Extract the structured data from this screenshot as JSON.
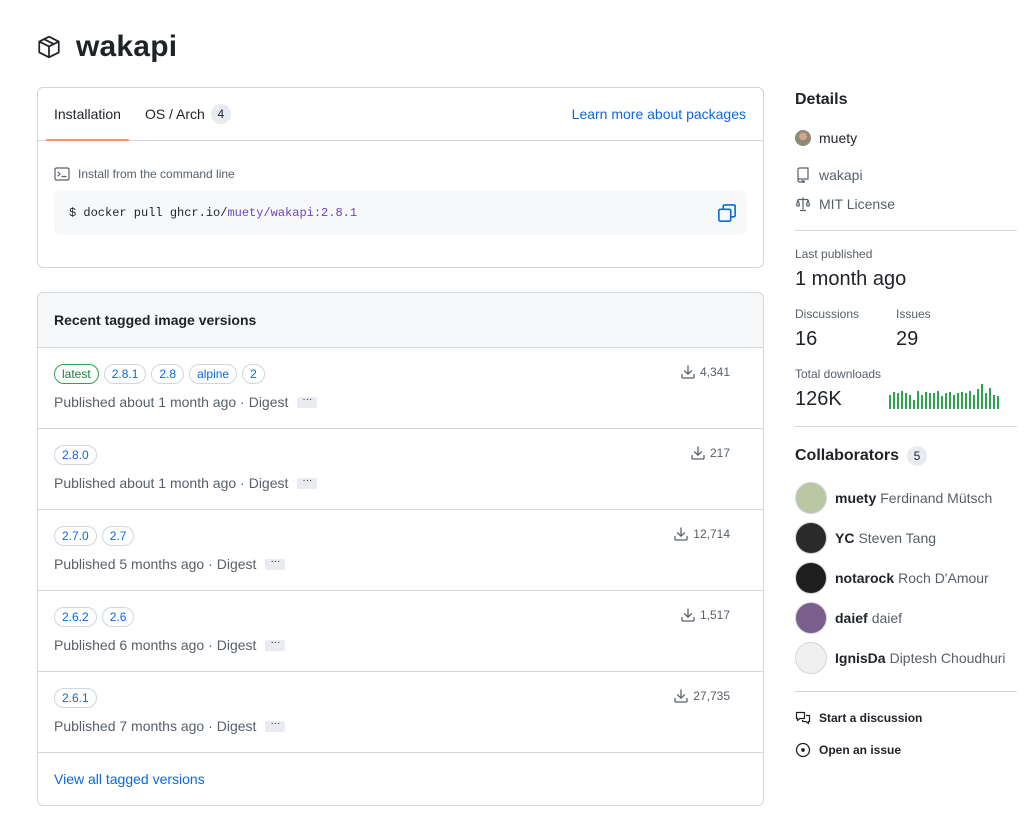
{
  "package": {
    "title": "wakapi",
    "icon": "package-icon"
  },
  "install": {
    "tabs": [
      {
        "label": "Installation"
      },
      {
        "label": "OS / Arch",
        "count": "4"
      }
    ],
    "learn_more": "Learn more about packages",
    "cli_label": "Install from the command line",
    "command_prefix": "$ docker pull ghcr.io/",
    "command_highlight": "muety/wakapi:2.8.1"
  },
  "versions": {
    "header": "Recent tagged image versions",
    "digest_label": "Digest",
    "ellipsis": "···",
    "rows": [
      {
        "tags": [
          "latest",
          "2.8.1",
          "2.8",
          "alpine",
          "2"
        ],
        "published": "Published about 1 month ago ·",
        "downloads": "4,341"
      },
      {
        "tags": [
          "2.8.0"
        ],
        "published": "Published about 1 month ago ·",
        "downloads": "217"
      },
      {
        "tags": [
          "2.7.0",
          "2.7"
        ],
        "published": "Published 5 months ago ·",
        "downloads": "12,714"
      },
      {
        "tags": [
          "2.6.2",
          "2.6"
        ],
        "published": "Published 6 months ago ·",
        "downloads": "1,517"
      },
      {
        "tags": [
          "2.6.1"
        ],
        "published": "Published 7 months ago ·",
        "downloads": "27,735"
      }
    ],
    "view_all": "View all tagged versions"
  },
  "details": {
    "heading": "Details",
    "owner": "muety",
    "repo": "wakapi",
    "license": "MIT License",
    "last_published_label": "Last published",
    "last_published_value": "1 month ago",
    "discussions_label": "Discussions",
    "discussions_value": "16",
    "issues_label": "Issues",
    "issues_value": "29",
    "total_downloads_label": "Total downloads",
    "total_downloads_value": "126K",
    "download_activity": [
      0.55,
      0.65,
      0.6,
      0.7,
      0.6,
      0.55,
      0.35,
      0.7,
      0.55,
      0.65,
      0.6,
      0.6,
      0.7,
      0.5,
      0.6,
      0.65,
      0.55,
      0.6,
      0.65,
      0.6,
      0.7,
      0.55,
      0.75,
      0.95,
      0.6,
      0.8,
      0.55,
      0.5
    ]
  },
  "collaborators": {
    "heading": "Collaborators",
    "count": "5",
    "list": [
      {
        "login": "muety",
        "name": "Ferdinand Mütsch",
        "avatar_color": "#b9c7a4"
      },
      {
        "login": "YC",
        "name": "Steven Tang",
        "avatar_color": "#2a2a2a"
      },
      {
        "login": "notarock",
        "name": "Roch D'Amour",
        "avatar_color": "#1e1e1e"
      },
      {
        "login": "daief",
        "name": "daief",
        "avatar_color": "#7a5f8c"
      },
      {
        "login": "IgnisDa",
        "name": "Diptesh Choudhuri",
        "avatar_color": "#f0f0f0"
      }
    ]
  },
  "actions": {
    "start_discussion": "Start a discussion",
    "open_issue": "Open an issue"
  },
  "colors": {
    "link": "#0969da",
    "accent_tab": "#fd8c73",
    "green": "#2da44e",
    "purple": "#6f42c1"
  }
}
